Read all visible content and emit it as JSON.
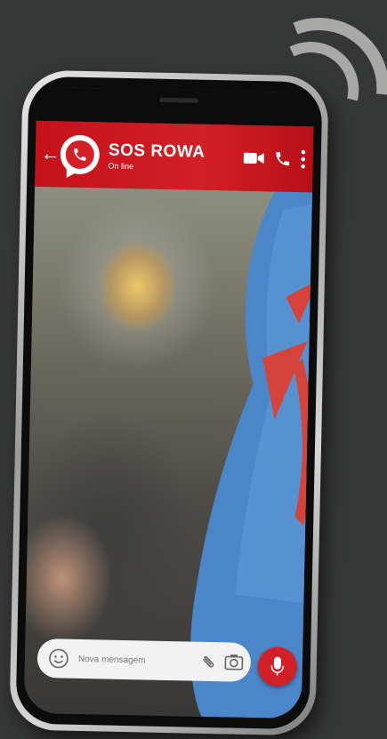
{
  "header": {
    "contact_name": "SOS ROWA",
    "contact_status": "On line"
  },
  "composer": {
    "placeholder": "Nova mensagem"
  },
  "icons": {
    "back": "arrow-left-icon",
    "logo": "chat-bubble-phone-logo",
    "video": "video-camera-icon",
    "call": "phone-icon",
    "menu": "more-vertical-icon",
    "emoji": "smiley-icon",
    "attach": "paperclip-icon",
    "camera": "camera-icon",
    "mic": "microphone-icon"
  },
  "colors": {
    "brand_red": "#d31f26",
    "background": "#353736",
    "sleeve_blue": "#4a86c8"
  }
}
